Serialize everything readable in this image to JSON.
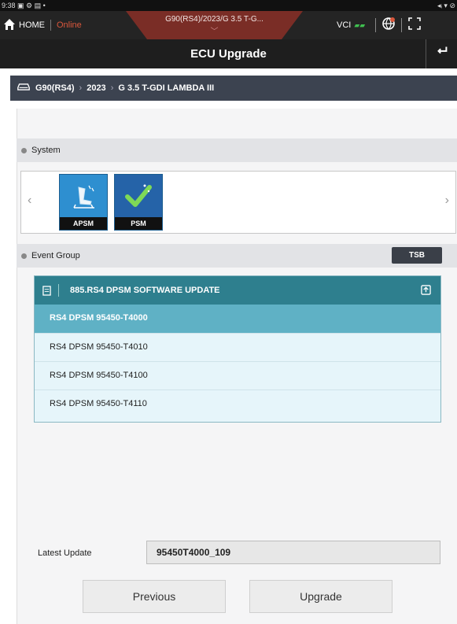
{
  "status_bar": {
    "time": "9:38",
    "left_icons": "▣ ⚙ ▤ •",
    "right_icons": "◂ᵢ ▾ ⊘"
  },
  "top_nav": {
    "home_label": "HOME",
    "online_label": "Online",
    "vehicle_tab": "G90(RS4)/2023/G 3.5 T-G...",
    "vci_label": "VCI"
  },
  "title": "ECU Upgrade",
  "breadcrumb": {
    "items": [
      "G90(RS4)",
      "2023",
      "G 3.5 T-GDI LAMBDA III"
    ]
  },
  "system_section": {
    "label": "System",
    "systems": [
      {
        "label": "APSM"
      },
      {
        "label": "PSM"
      }
    ]
  },
  "event_group": {
    "label": "Event Group",
    "tsb_label": "TSB",
    "header": "885.RS4 DPSM SOFTWARE UPDATE",
    "rows": [
      {
        "label": "RS4 DPSM 95450-T4000",
        "selected": true
      },
      {
        "label": "RS4 DPSM 95450-T4010",
        "selected": false
      },
      {
        "label": "RS4 DPSM 95450-T4100",
        "selected": false
      },
      {
        "label": "RS4 DPSM 95450-T4110",
        "selected": false
      }
    ]
  },
  "latest_update": {
    "label": "Latest Update",
    "value": "95450T4000_109"
  },
  "buttons": {
    "previous": "Previous",
    "upgrade": "Upgrade"
  },
  "colors": {
    "accent_teal": "#2e7f8e",
    "selected_row": "#5fb1c5",
    "online_red": "#d9573c",
    "vehicle_tab": "#7a2d26"
  }
}
